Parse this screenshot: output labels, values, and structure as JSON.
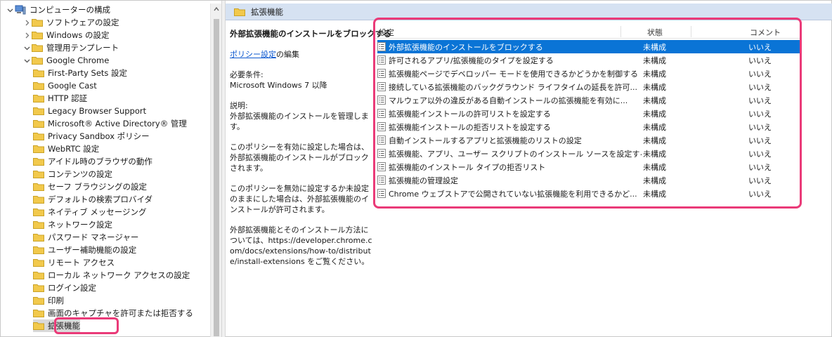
{
  "tree": {
    "items": [
      {
        "label": "コンピューターの構成",
        "level": 0,
        "icon": "computer-icon",
        "expander": "expanded"
      },
      {
        "label": "ソフトウェアの設定",
        "level": 1,
        "icon": "folder-icon",
        "expander": "collapsed"
      },
      {
        "label": "Windows の設定",
        "level": 1,
        "icon": "folder-icon",
        "expander": "collapsed"
      },
      {
        "label": "管理用テンプレート",
        "level": 1,
        "icon": "folder-icon",
        "expander": "expanded"
      },
      {
        "label": "Google Chrome",
        "level": 2,
        "icon": "folder-icon",
        "expander": "expanded"
      },
      {
        "label": "First-Party Sets 設定",
        "level": 3,
        "icon": "folder-icon",
        "expander": "none"
      },
      {
        "label": "Google Cast",
        "level": 3,
        "icon": "folder-icon",
        "expander": "none"
      },
      {
        "label": "HTTP 認証",
        "level": 3,
        "icon": "folder-icon",
        "expander": "none"
      },
      {
        "label": "Legacy Browser Support",
        "level": 3,
        "icon": "folder-icon",
        "expander": "none"
      },
      {
        "label": "Microsoft® Active Directory® 管理",
        "level": 3,
        "icon": "folder-icon",
        "expander": "none"
      },
      {
        "label": "Privacy Sandbox ポリシー",
        "level": 3,
        "icon": "folder-icon",
        "expander": "none"
      },
      {
        "label": "WebRTC 設定",
        "level": 3,
        "icon": "folder-icon",
        "expander": "none"
      },
      {
        "label": "アイドル時のブラウザの動作",
        "level": 3,
        "icon": "folder-icon",
        "expander": "none"
      },
      {
        "label": "コンテンツの設定",
        "level": 3,
        "icon": "folder-icon",
        "expander": "none"
      },
      {
        "label": "セーフ ブラウジングの設定",
        "level": 3,
        "icon": "folder-icon",
        "expander": "none"
      },
      {
        "label": "デフォルトの検索プロバイダ",
        "level": 3,
        "icon": "folder-icon",
        "expander": "none"
      },
      {
        "label": "ネイティブ メッセージング",
        "level": 3,
        "icon": "folder-icon",
        "expander": "none"
      },
      {
        "label": "ネットワーク設定",
        "level": 3,
        "icon": "folder-icon",
        "expander": "none"
      },
      {
        "label": "パスワード マネージャー",
        "level": 3,
        "icon": "folder-icon",
        "expander": "none"
      },
      {
        "label": "ユーザー補助機能の設定",
        "level": 3,
        "icon": "folder-icon",
        "expander": "none"
      },
      {
        "label": "リモート アクセス",
        "level": 3,
        "icon": "folder-icon",
        "expander": "none"
      },
      {
        "label": "ローカル ネットワーク アクセスの設定",
        "level": 3,
        "icon": "folder-icon",
        "expander": "none"
      },
      {
        "label": "ログイン設定",
        "level": 3,
        "icon": "folder-icon",
        "expander": "none"
      },
      {
        "label": "印刷",
        "level": 3,
        "icon": "folder-icon",
        "expander": "none"
      },
      {
        "label": "画面のキャプチャを許可または拒否する",
        "level": 3,
        "icon": "folder-icon",
        "expander": "none"
      },
      {
        "label": "拡張機能",
        "level": 3,
        "icon": "folder-icon",
        "expander": "none",
        "selected": true
      }
    ]
  },
  "breadcrumb": {
    "label": "拡張機能"
  },
  "description": {
    "title": "外部拡張機能のインストールをブロックする",
    "edit_link": "ポリシー設定",
    "edit_suffix": "の編集",
    "requirements_label": "必要条件:",
    "requirements_value": "Microsoft Windows 7 以降",
    "explain_label": "説明:",
    "explain_text": "外部拡張機能のインストールを管理します。",
    "enabled_text": "このポリシーを有効に設定した場合は、外部拡張機能のインストールがブロックされます。",
    "disabled_text": "このポリシーを無効に設定するか未設定のままにした場合は、外部拡張機能のインストールが許可されます。",
    "more_text": "外部拡張機能とそのインストール方法については、https://developer.chrome.com/docs/extensions/how-to/distribute/install-extensions をご覧ください。"
  },
  "list": {
    "columns": {
      "setting": "設定",
      "state": "状態",
      "comment": "コメント"
    },
    "rows": [
      {
        "name": "外部拡張機能のインストールをブロックする",
        "state": "未構成",
        "comment": "いいえ",
        "selected": true
      },
      {
        "name": "許可されるアプリ/拡張機能のタイプを設定する",
        "state": "未構成",
        "comment": "いいえ"
      },
      {
        "name": "拡張機能ページでデベロッパー モードを使用できるかどうかを制御する",
        "state": "未構成",
        "comment": "いいえ"
      },
      {
        "name": "接続している拡張機能のバックグラウンド ライフタイムの延長を許可...",
        "state": "未構成",
        "comment": "いいえ"
      },
      {
        "name": "マルウェア以外の違反がある自動インストールの拡張機能を有効に...",
        "state": "未構成",
        "comment": "いいえ"
      },
      {
        "name": "拡張機能インストールの許可リストを設定する",
        "state": "未構成",
        "comment": "いいえ"
      },
      {
        "name": "拡張機能インストールの拒否リストを設定する",
        "state": "未構成",
        "comment": "いいえ"
      },
      {
        "name": "自動インストールするアプリと拡張機能のリストの設定",
        "state": "未構成",
        "comment": "いいえ"
      },
      {
        "name": "拡張機能、アプリ、ユーザー スクリプトのインストール ソースを設定する",
        "state": "未構成",
        "comment": "いいえ"
      },
      {
        "name": "拡張機能のインストール タイプの拒否リスト",
        "state": "未構成",
        "comment": "いいえ"
      },
      {
        "name": "拡張機能の管理設定",
        "state": "未構成",
        "comment": "いいえ"
      },
      {
        "name": "Chrome ウェブストアで公開されていない拡張機能を利用できるかど...",
        "state": "未構成",
        "comment": "いいえ"
      }
    ]
  },
  "colors": {
    "selection": "#0a74d6",
    "highlight": "#ea3a78",
    "header_bar": "#d6e2f2",
    "folder": "#f2c94c"
  }
}
